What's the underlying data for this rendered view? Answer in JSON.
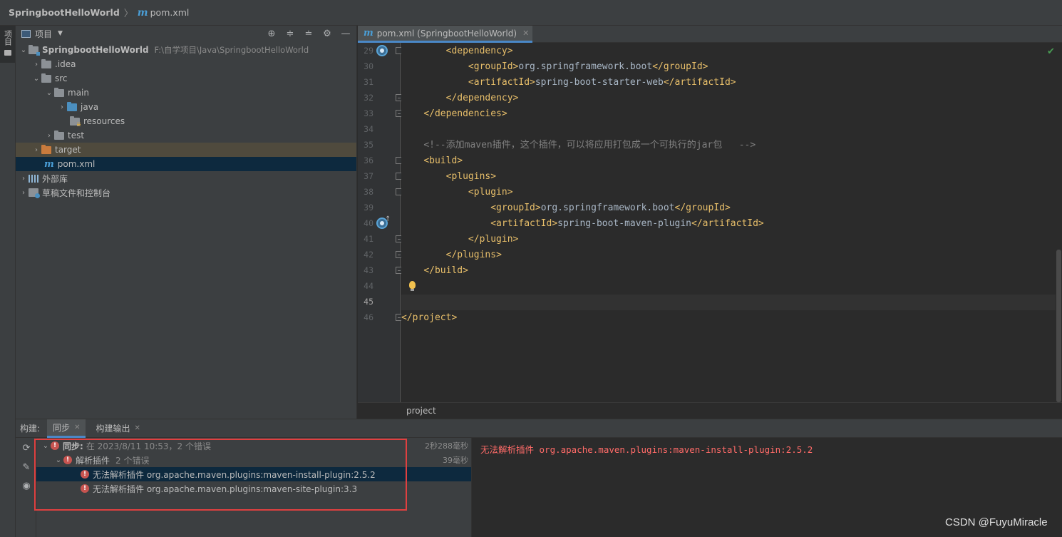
{
  "navbar": {
    "project": "SpringbootHelloWorld",
    "file": "pom.xml",
    "m_glyph": "m"
  },
  "left_strip": {
    "project_tab": "项目"
  },
  "project_panel": {
    "title": "项目",
    "tree": {
      "root": {
        "label": "SpringbootHelloWorld",
        "path": "F:\\自学项目\\Java\\SpringbootHelloWorld"
      },
      "idea": ".idea",
      "src": "src",
      "main": "main",
      "java": "java",
      "resources": "resources",
      "test": "test",
      "target": "target",
      "pom": "pom.xml",
      "external_libs": "外部库",
      "scratches": "草稿文件和控制台"
    }
  },
  "editor": {
    "tab_label": "pom.xml (SpringbootHelloWorld)",
    "breadcrumb": "project",
    "lines": [
      {
        "no": "29",
        "indent": "        ",
        "parts": [
          [
            "tag",
            "<dependency>"
          ]
        ]
      },
      {
        "no": "30",
        "indent": "            ",
        "parts": [
          [
            "tag",
            "<groupId>"
          ],
          [
            "txt",
            "org.springframework.boot"
          ],
          [
            "tag",
            "</groupId>"
          ]
        ]
      },
      {
        "no": "31",
        "indent": "            ",
        "parts": [
          [
            "tag",
            "<artifactId>"
          ],
          [
            "txt",
            "spring-boot-starter-web"
          ],
          [
            "tag",
            "</artifactId>"
          ]
        ]
      },
      {
        "no": "32",
        "indent": "        ",
        "parts": [
          [
            "tag",
            "</dependency>"
          ]
        ]
      },
      {
        "no": "33",
        "indent": "    ",
        "parts": [
          [
            "tag",
            "</dependencies>"
          ]
        ]
      },
      {
        "no": "34",
        "indent": "",
        "parts": []
      },
      {
        "no": "35",
        "indent": "    ",
        "parts": [
          [
            "cmt",
            "<!--添加maven插件，这个插件，可以将应用打包成一个可执行的jar包   -->"
          ]
        ]
      },
      {
        "no": "36",
        "indent": "    ",
        "parts": [
          [
            "tag",
            "<build>"
          ]
        ]
      },
      {
        "no": "37",
        "indent": "        ",
        "parts": [
          [
            "tag",
            "<plugins>"
          ]
        ]
      },
      {
        "no": "38",
        "indent": "            ",
        "parts": [
          [
            "tag",
            "<plugin>"
          ]
        ]
      },
      {
        "no": "39",
        "indent": "                ",
        "parts": [
          [
            "tag",
            "<groupId>"
          ],
          [
            "txt",
            "org.springframework.boot"
          ],
          [
            "tag",
            "</groupId>"
          ]
        ]
      },
      {
        "no": "40",
        "indent": "                ",
        "parts": [
          [
            "tag",
            "<artifactId>"
          ],
          [
            "txt",
            "spring-boot-maven-plugin"
          ],
          [
            "tag",
            "</artifactId>"
          ]
        ]
      },
      {
        "no": "41",
        "indent": "            ",
        "parts": [
          [
            "tag",
            "</plugin>"
          ]
        ]
      },
      {
        "no": "42",
        "indent": "        ",
        "parts": [
          [
            "tag",
            "</plugins>"
          ]
        ]
      },
      {
        "no": "43",
        "indent": "    ",
        "parts": [
          [
            "tag",
            "</build>"
          ]
        ]
      },
      {
        "no": "44",
        "indent": "",
        "parts": []
      },
      {
        "no": "45",
        "indent": "",
        "parts": []
      },
      {
        "no": "46",
        "indent": "",
        "parts": [
          [
            "tag",
            "</project>"
          ]
        ]
      }
    ]
  },
  "build": {
    "label": "构建:",
    "tabs": [
      "同步",
      "构建输出"
    ],
    "sync_row": {
      "title": "同步:",
      "detail": "在 2023/8/11 10:53，2 个错误",
      "duration": "2秒288毫秒"
    },
    "resolve_row": {
      "title": "解析插件",
      "detail": "2 个错误",
      "duration": "39毫秒"
    },
    "errors": [
      "无法解析插件 org.apache.maven.plugins:maven-install-plugin:2.5.2",
      "无法解析插件 org.apache.maven.plugins:maven-site-plugin:3.3"
    ],
    "output": "无法解析插件 org.apache.maven.plugins:maven-install-plugin:2.5.2"
  },
  "watermark": "CSDN @FuyuMiracle",
  "colors": {
    "accent": "#4a88c7",
    "error": "#c75450",
    "tag": "#e8bf6a",
    "text": "#a9b7c6",
    "highlight_box": "#e04040"
  }
}
